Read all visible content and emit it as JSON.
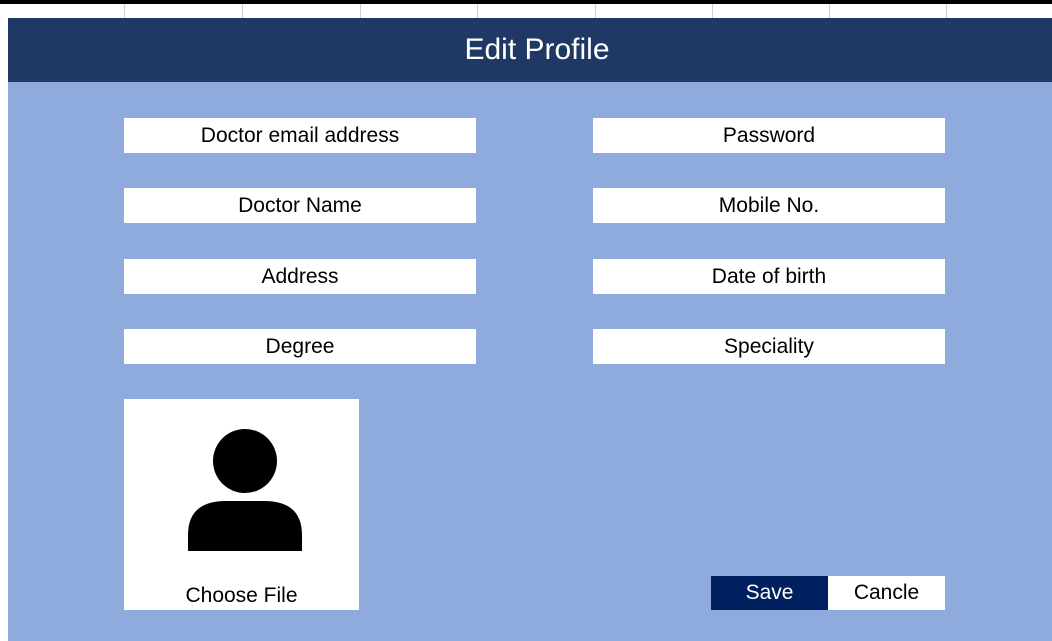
{
  "header": {
    "title": "Edit Profile"
  },
  "form": {
    "left_fields": [
      {
        "placeholder": "Doctor email address"
      },
      {
        "placeholder": "Doctor Name"
      },
      {
        "placeholder": "Address"
      },
      {
        "placeholder": "Degree"
      }
    ],
    "right_fields": [
      {
        "placeholder": "Password"
      },
      {
        "placeholder": "Mobile No."
      },
      {
        "placeholder": "Date of birth"
      },
      {
        "placeholder": "Speciality"
      }
    ]
  },
  "photo": {
    "icon": "user-avatar-icon",
    "choose_label": "Choose File"
  },
  "actions": {
    "save_label": "Save",
    "cancel_label": "Cancle"
  },
  "colors": {
    "header_bg": "#203864",
    "panel_bg": "#8faadc",
    "save_bg": "#002060",
    "field_bg": "#ffffff"
  }
}
